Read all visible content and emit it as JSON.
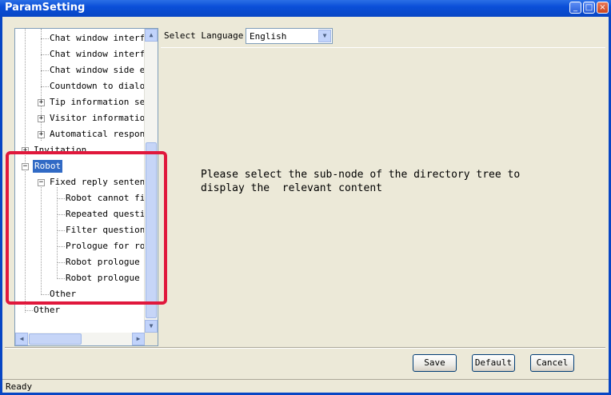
{
  "window": {
    "title": "ParamSetting"
  },
  "tree": {
    "items": [
      "Chat window interfac",
      "Chat window interfac",
      "Chat window side edg",
      "Countdown to dialog",
      "Tip information sett",
      "Visitor information",
      "Automatical response",
      "Invitation",
      "Robot",
      "Fixed reply sentence",
      "Robot cannot find",
      "Repeated question",
      "Filter question",
      "Prologue for robo",
      "Robot prologue fo",
      "Robot prologue fo",
      "Other",
      "Other"
    ],
    "selected": "Robot"
  },
  "language": {
    "label": "Select Language",
    "value": "English"
  },
  "message": "Please select the sub-node of the directory tree to\ndisplay the  relevant content",
  "buttons": {
    "save": "Save",
    "default": "Default",
    "cancel": "Cancel"
  },
  "status": "Ready",
  "colors": {
    "highlight": "#e0183c",
    "title_bar": "#0a4fd8",
    "selection": "#316ac5"
  }
}
